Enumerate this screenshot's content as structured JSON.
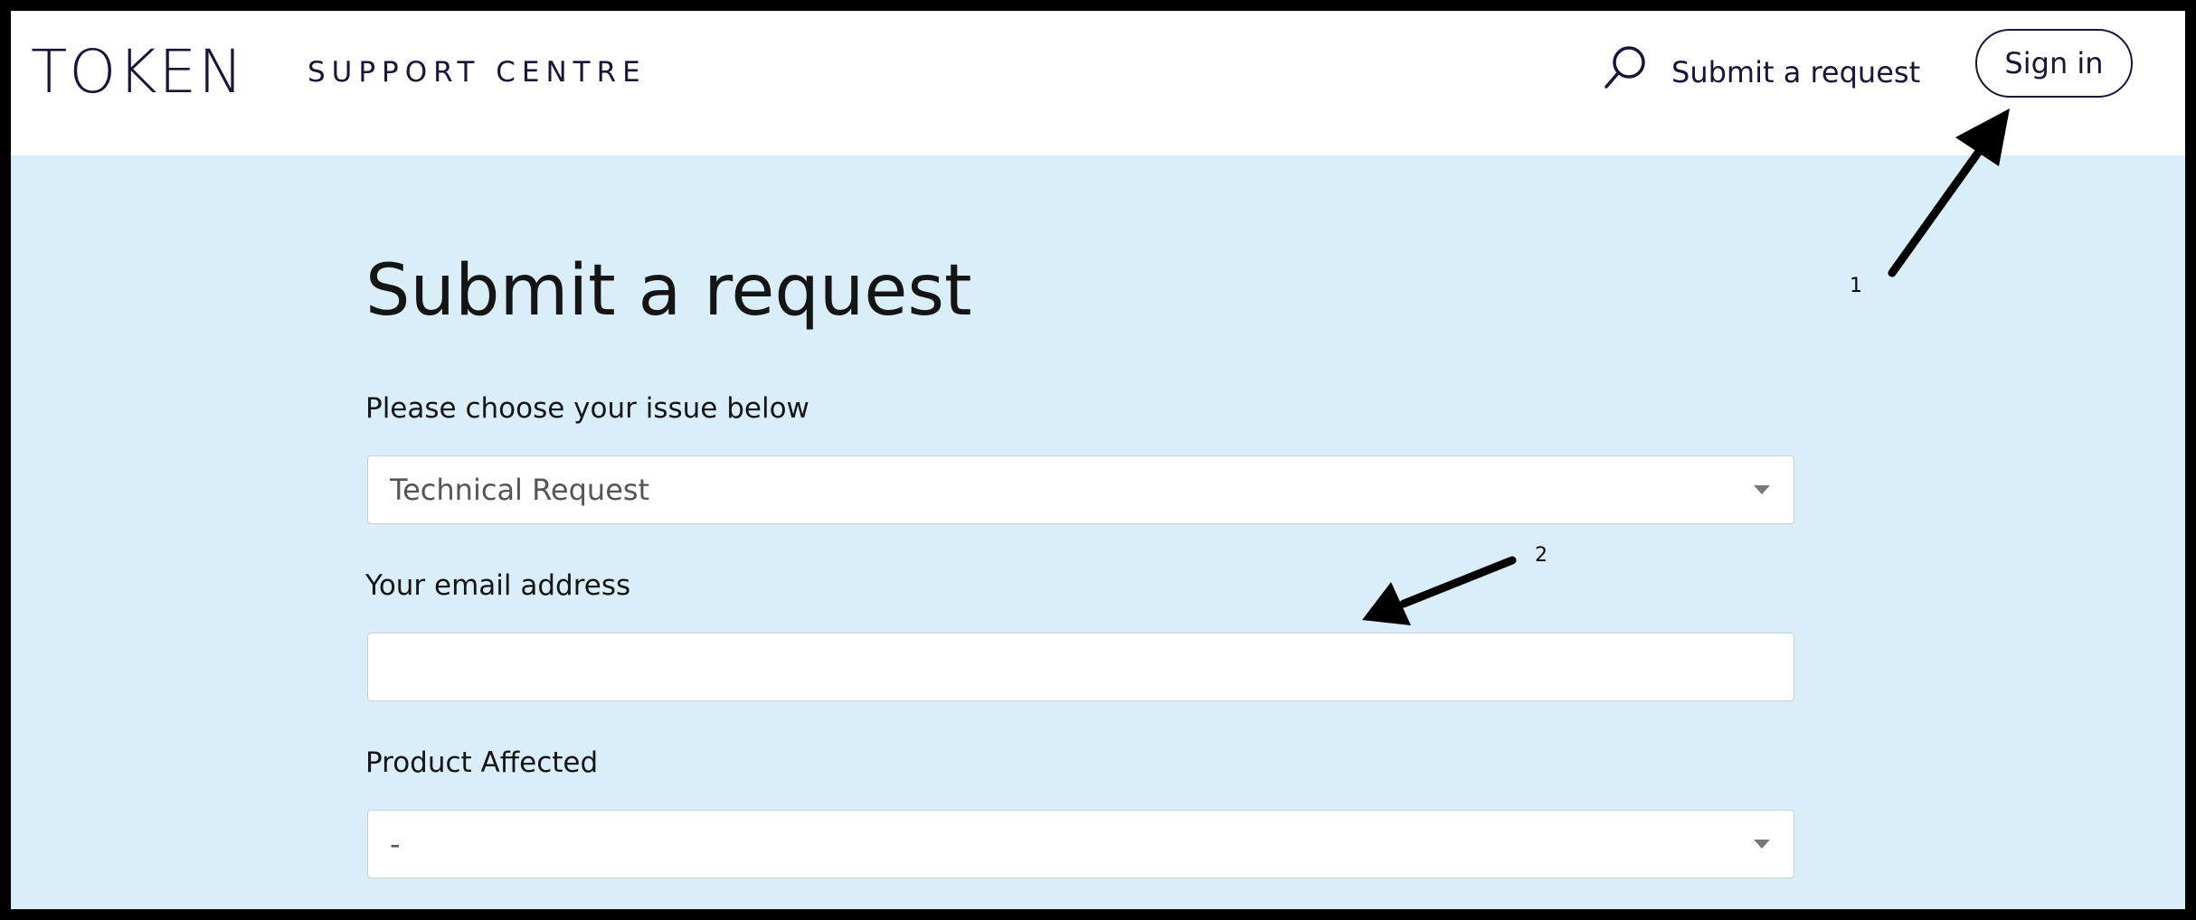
{
  "header": {
    "logo": "TOKEN",
    "brand_sub": "SUPPORT CENTRE",
    "search_icon": "search-icon",
    "nav_link": "Submit a request",
    "sign_in": "Sign in"
  },
  "main": {
    "title": "Submit a request",
    "issue_field": {
      "label": "Please choose your issue below",
      "value": "Technical Request"
    },
    "email_field": {
      "label": "Your email address",
      "value": ""
    },
    "product_field": {
      "label": "Product Affected",
      "value": "-"
    }
  },
  "annotations": {
    "marker_1": "1",
    "marker_2": "2"
  },
  "colors": {
    "page_background": "#daeefa",
    "header_background": "#ffffff",
    "brand_text": "#1c1438"
  }
}
